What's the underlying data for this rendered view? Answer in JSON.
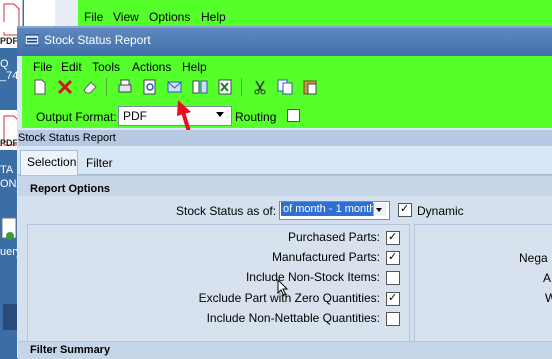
{
  "desktop": {
    "icons": [
      {
        "label_top": "Q",
        "label_bottom": "_74"
      },
      {
        "label_top": "TA",
        "label_bottom": "ONA"
      },
      {
        "label_top": "",
        "label_bottom": "uery"
      }
    ],
    "pdf_badge": "PDF"
  },
  "background_window": {
    "menu": [
      "File",
      "View",
      "Options",
      "Help"
    ]
  },
  "window": {
    "title": "Stock Status Report",
    "menu": [
      "File",
      "Edit",
      "Tools",
      "Actions",
      "Help"
    ],
    "toolbar_icons": [
      "new-icon",
      "delete-icon",
      "clear-icon",
      "print-icon",
      "preview-icon",
      "send-icon",
      "export-icon",
      "excel-icon",
      "cut-icon",
      "copy-icon",
      "paste-icon"
    ],
    "output_format_label": "Output Format:",
    "output_format_value": "PDF",
    "routing_label": "Routing",
    "routing_checked": false
  },
  "panel": {
    "title": "Stock Status Report",
    "tabs": [
      "Selection",
      "Filter"
    ],
    "selected_tab": "Selection"
  },
  "report_options": {
    "heading": "Report Options",
    "stock_status_label": "Stock Status as of:",
    "stock_status_value": "of month - 1 month",
    "dynamic_label": "Dynamic",
    "dynamic_checked": true,
    "options": [
      {
        "label": "Purchased Parts:",
        "checked": true
      },
      {
        "label": "Manufactured Parts:",
        "checked": true
      },
      {
        "label": "Include Non-Stock Items:",
        "checked": false
      },
      {
        "label": "Exclude Part with Zero Quantities:",
        "checked": true
      },
      {
        "label": "Include Non-Nettable Quantities:",
        "checked": false
      }
    ],
    "right_fragments": [
      "Nega",
      "A",
      "W"
    ]
  },
  "filter_summary": {
    "heading": "Filter Summary"
  },
  "colors": {
    "green_toolbar": "#55ff2a",
    "title_bar": "#436fa9",
    "arrow": "#e8101a"
  }
}
